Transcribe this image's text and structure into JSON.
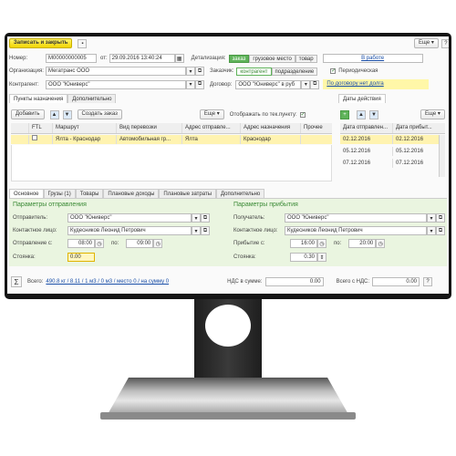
{
  "toolbar": {
    "save_close": "Записать и закрыть",
    "more": "Еще"
  },
  "header": {
    "number_label": "Номер:",
    "number_value": "М00000000005",
    "from_label": "от:",
    "date_value": "29.09.2016 13:40:24",
    "detail_label": "Детализация:",
    "detail_options": [
      "заказ",
      "грузовое место",
      "товар"
    ],
    "work_link": "В работе",
    "org_label": "Организация:",
    "org_value": "Мегатранс ООО",
    "customer_label": "Заказчик:",
    "customer_options": [
      "контрагент",
      "подразделение"
    ],
    "periodic_label": "Периодическая",
    "contragent_label": "Контрагент:",
    "contragent_value": "ООО \"Юниверс\"",
    "contract_label": "Договор:",
    "contract_value": "ООО \"Юниверс\" в руб",
    "debt_link": "По договору нет долга"
  },
  "points": {
    "tabs": [
      "Пункты назначения",
      "Дополнительно"
    ],
    "add_btn": "Добавить",
    "create_order_btn": "Создать заказ",
    "more": "Еще",
    "show_label": "Отображать по тек.пункту:",
    "columns": [
      "",
      "FTL",
      "Маршрут",
      "Вид перевозки",
      "Адрес отправле...",
      "Адрес назначения",
      "Прочее"
    ],
    "rows": [
      {
        "num": "",
        "ftl": "",
        "route": "Ялта - Краснодар",
        "type": "Автомобильная гр...",
        "from": "Ялта",
        "to": "Краснодар",
        "other": ""
      }
    ]
  },
  "dates": {
    "tab": "Даты действия",
    "more": "Еще",
    "columns": [
      "Дата отправлен...",
      "Дата прибыт..."
    ],
    "rows": [
      [
        "02.12.2016",
        "02.12.2016"
      ],
      [
        "05.12.2016",
        "05.12.2016"
      ],
      [
        "07.12.2016",
        "07.12.2016"
      ]
    ]
  },
  "detail_tabs": [
    "Основное",
    "Грузы (1)",
    "Товары",
    "Плановые доходы",
    "Плановые затраты",
    "Дополнительно"
  ],
  "departure": {
    "title": "Параметры отправления",
    "sender_label": "Отправитель:",
    "sender_value": "ООО \"Юниверс\"",
    "contact_label": "Контактное лицо:",
    "contact_value": "Кудесников Леонид Петрович",
    "from_label": "Отправление с:",
    "from_value": "08:00",
    "to_label": "по:",
    "to_value": "09:00",
    "stay_label": "Стоянка:",
    "stay_value": "0.00"
  },
  "arrival": {
    "title": "Параметры прибытия",
    "recipient_label": "Получатель:",
    "recipient_value": "ООО \"Юниверс\"",
    "contact_label": "Контактное лицо:",
    "contact_value": "Кудесников Леонид Петрович",
    "from_label": "Прибытие с:",
    "from_value": "16:00",
    "to_label": "по:",
    "to_value": "20:00",
    "stay_label": "Стоянка:",
    "stay_value": "0.30"
  },
  "footer": {
    "sigma": "Σ",
    "total_label": "Всего:",
    "total_link": "490.8 кг / 8.11 / 1 м3 / 0 м3 / место 0 / на сумму 0",
    "vat_label": "НДС в сумме:",
    "vat_value": "0.00",
    "total_vat_label": "Всего с НДС:",
    "total_vat_value": "0.00"
  }
}
